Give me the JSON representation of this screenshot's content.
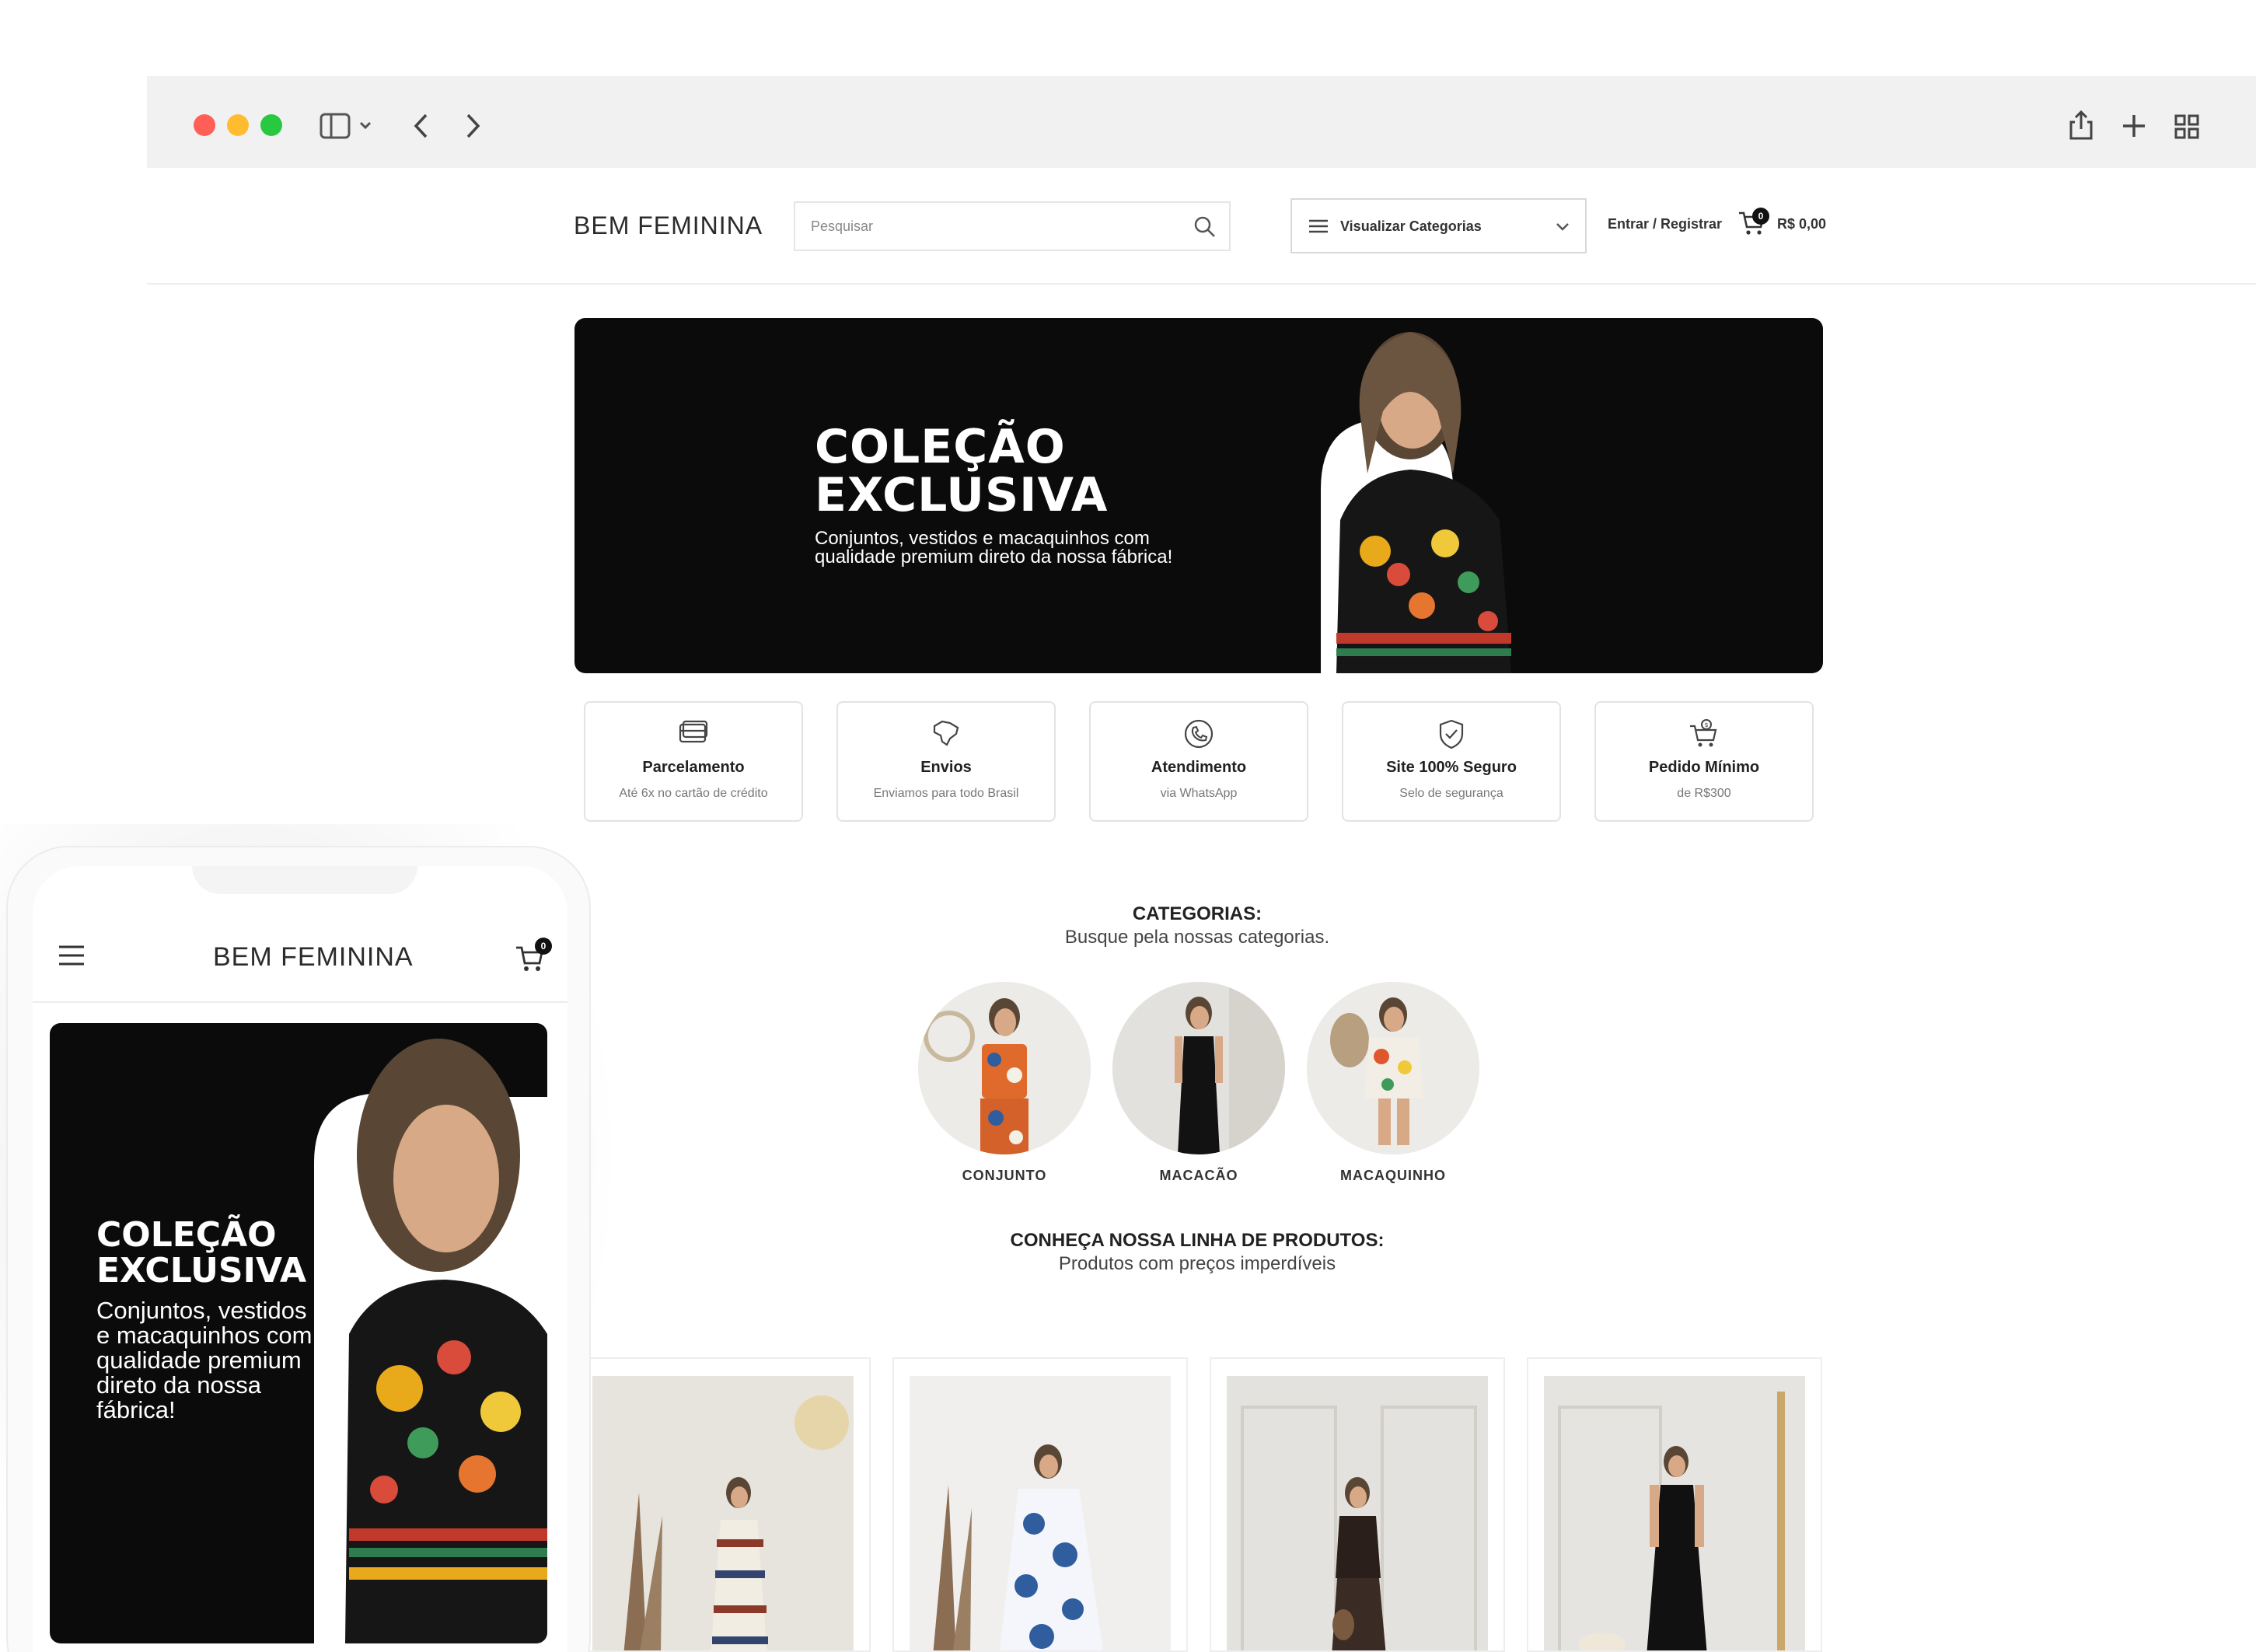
{
  "site": {
    "logo": "BEM FEMININA",
    "search_placeholder": "Pesquisar",
    "categories_dropdown": "Visualizar Categorias",
    "login": "Entrar / Registrar",
    "cart_count": "0",
    "cart_total": "R$ 0,00"
  },
  "hero": {
    "title": "COLEÇÃO\nEXCLUSIVA",
    "subtitle": "Conjuntos, vestidos e macaquinhos com qualidade premium direto da nossa fábrica!"
  },
  "features": [
    {
      "icon": "credit-card-icon",
      "title": "Parcelamento",
      "subtitle": "Até 6x no cartão de crédito"
    },
    {
      "icon": "brazil-map-icon",
      "title": "Envios",
      "subtitle": "Enviamos para todo Brasil"
    },
    {
      "icon": "phone-icon",
      "title": "Atendimento",
      "subtitle": "via WhatsApp"
    },
    {
      "icon": "shield-check-icon",
      "title": "Site 100% Seguro",
      "subtitle": "Selo de segurança"
    },
    {
      "icon": "cart-money-icon",
      "title": "Pedido Mínimo",
      "subtitle": "de R$300"
    }
  ],
  "categories_section": {
    "title": "CATEGORIAS:",
    "subtitle": "Busque pela nossas categorias.",
    "items": [
      {
        "label": "CONJUNTO"
      },
      {
        "label": "MACACÃO"
      },
      {
        "label": "MACAQUINHO"
      }
    ]
  },
  "products_section": {
    "title": "CONHEÇA NOSSA LINHA DE PRODUTOS:",
    "subtitle": "Produtos com preços imperdíveis"
  },
  "mobile": {
    "logo": "BEM FEMININA",
    "cart_count": "0",
    "hero_title": "COLEÇÃO\nEXCLUSIVA",
    "hero_subtitle": "Conjuntos, vestidos e macaquinhos com qualidade premium direto da nossa fábrica!"
  },
  "colors": {
    "traffic_red": "#ff5f57",
    "traffic_yellow": "#febc2e",
    "traffic_green": "#28c840",
    "hero_bg": "#0b0b0b",
    "accent": "#111111"
  }
}
